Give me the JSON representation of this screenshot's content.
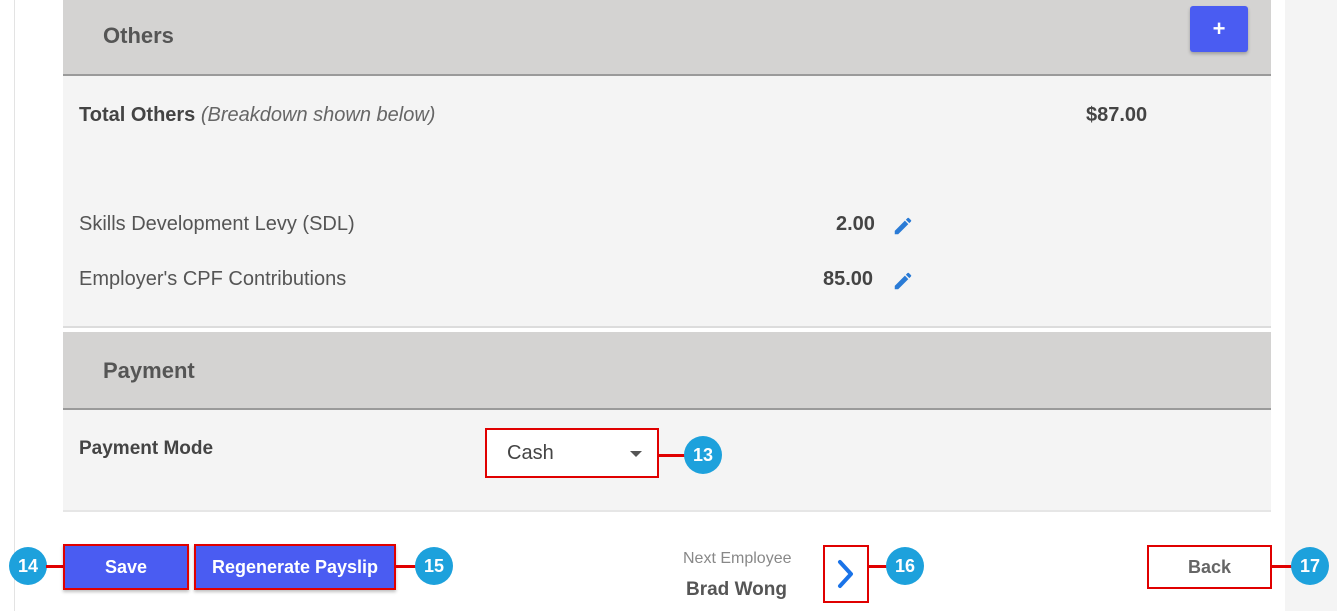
{
  "others": {
    "title": "Others",
    "add_label": "+",
    "total_label": "Total Others",
    "total_note": "(Breakdown shown below)",
    "total_value": "$87.00",
    "items": [
      {
        "label": "Skills Development Levy (SDL)",
        "value": "2.00",
        "icon": "pencil-icon"
      },
      {
        "label": "Employer's CPF Contributions",
        "value": "85.00",
        "icon": "pencil-icon"
      }
    ]
  },
  "payment": {
    "title": "Payment",
    "mode_label": "Payment Mode",
    "mode_value": "Cash"
  },
  "footer": {
    "save_label": "Save",
    "regenerate_label": "Regenerate Payslip",
    "next_caption": "Next Employee",
    "next_name": "Brad Wong",
    "back_label": "Back"
  },
  "callouts": [
    "13",
    "14",
    "15",
    "16",
    "17"
  ],
  "colors": {
    "accent": "#4a5cf2",
    "callout": "#1da1dc",
    "highlight": "#e00000",
    "section_header": "#d4d3d2",
    "panel": "#f4f4f4",
    "link_blue": "#1a73e8"
  }
}
